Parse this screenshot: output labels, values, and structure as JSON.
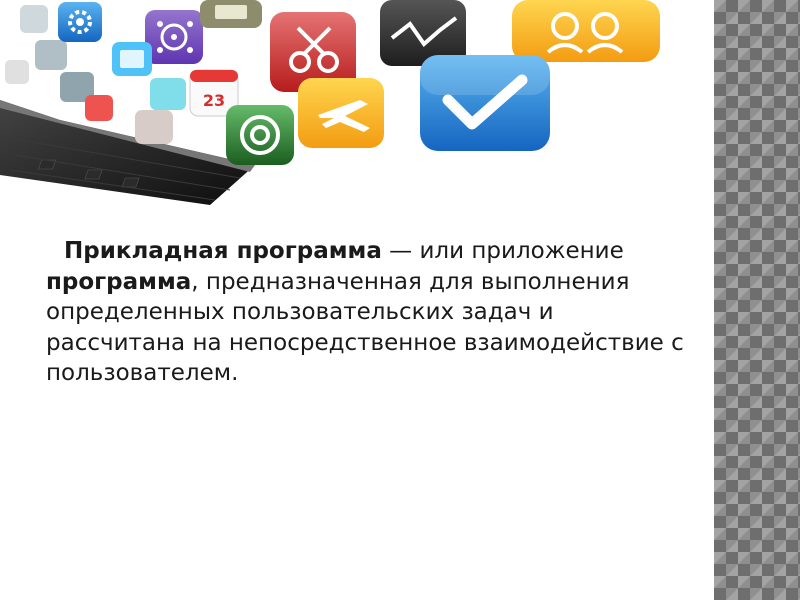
{
  "slide": {
    "paragraph": {
      "term": "Прикладная программа",
      "part1": " — или приложение ",
      "term2": "программа",
      "part2": ", предназначенная для выполнения определенных пользовательских задач и рассчитана на непосредственное взаимодействие с пользователем."
    },
    "illustration": {
      "calendar_number": "23",
      "icons": [
        "gear-icon",
        "settings-network-icon",
        "gallery-icon",
        "scissors-icon",
        "chart-line-icon",
        "people-icon",
        "checkmark-icon",
        "airplane-icon",
        "target-icon",
        "calendar-icon",
        "keyboard-icon"
      ]
    }
  }
}
